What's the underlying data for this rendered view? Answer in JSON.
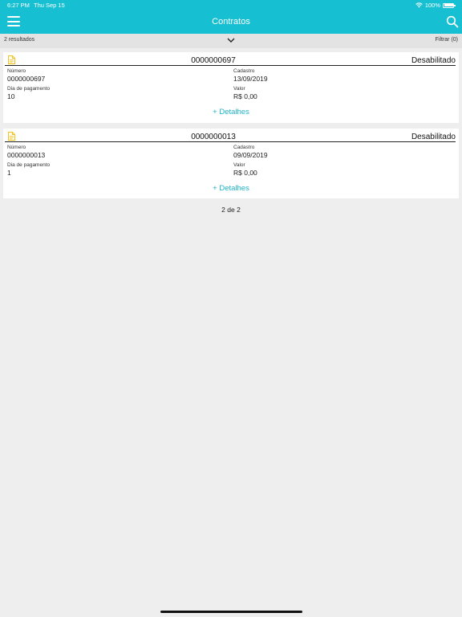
{
  "status_bar": {
    "time": "6:27 PM",
    "date": "Thu Sep 15",
    "battery": "100%"
  },
  "header": {
    "title": "Contratos"
  },
  "toolbar": {
    "results": "2 resultados",
    "filter_label": "Filtrar (0)"
  },
  "labels": {
    "numero": "Número",
    "cadastro": "Cadastro",
    "dia_pagamento": "Dia de pagamento",
    "valor": "Valor",
    "details": "+ Detalhes"
  },
  "contracts": [
    {
      "number": "0000000697",
      "status": "Desabilitado",
      "numero": "0000000697",
      "cadastro": "13/09/2019",
      "dia_pagamento": "10",
      "valor": "R$ 0,00"
    },
    {
      "number": "0000000013",
      "status": "Desabilitado",
      "numero": "0000000013",
      "cadastro": "09/09/2019",
      "dia_pagamento": "1",
      "valor": "R$ 0,00"
    }
  ],
  "pager": {
    "text": "2 de 2"
  },
  "colors": {
    "header": "#16bfd1",
    "link": "#1cb4c6",
    "doc_icon": "#f2c21b",
    "background": "#eeeeee"
  },
  "icons": [
    "menu-icon",
    "search-icon",
    "chevron-down-icon",
    "document-icon",
    "wifi-icon",
    "battery-icon"
  ]
}
